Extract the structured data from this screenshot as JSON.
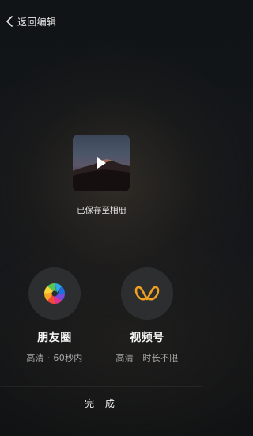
{
  "header": {
    "back_label": "返回编辑"
  },
  "preview": {
    "saved_text": "已保存至相册"
  },
  "share_targets": [
    {
      "name": "朋友圈",
      "detail": "高清 · 60秒内",
      "icon": "moments-aperture-icon"
    },
    {
      "name": "视频号",
      "detail": "高清 · 时长不限",
      "icon": "channels-icon"
    }
  ],
  "footer": {
    "done_label": "完 成"
  },
  "colors": {
    "channels_orange": "#f0a020",
    "circle_bg": "#2d2e30"
  }
}
